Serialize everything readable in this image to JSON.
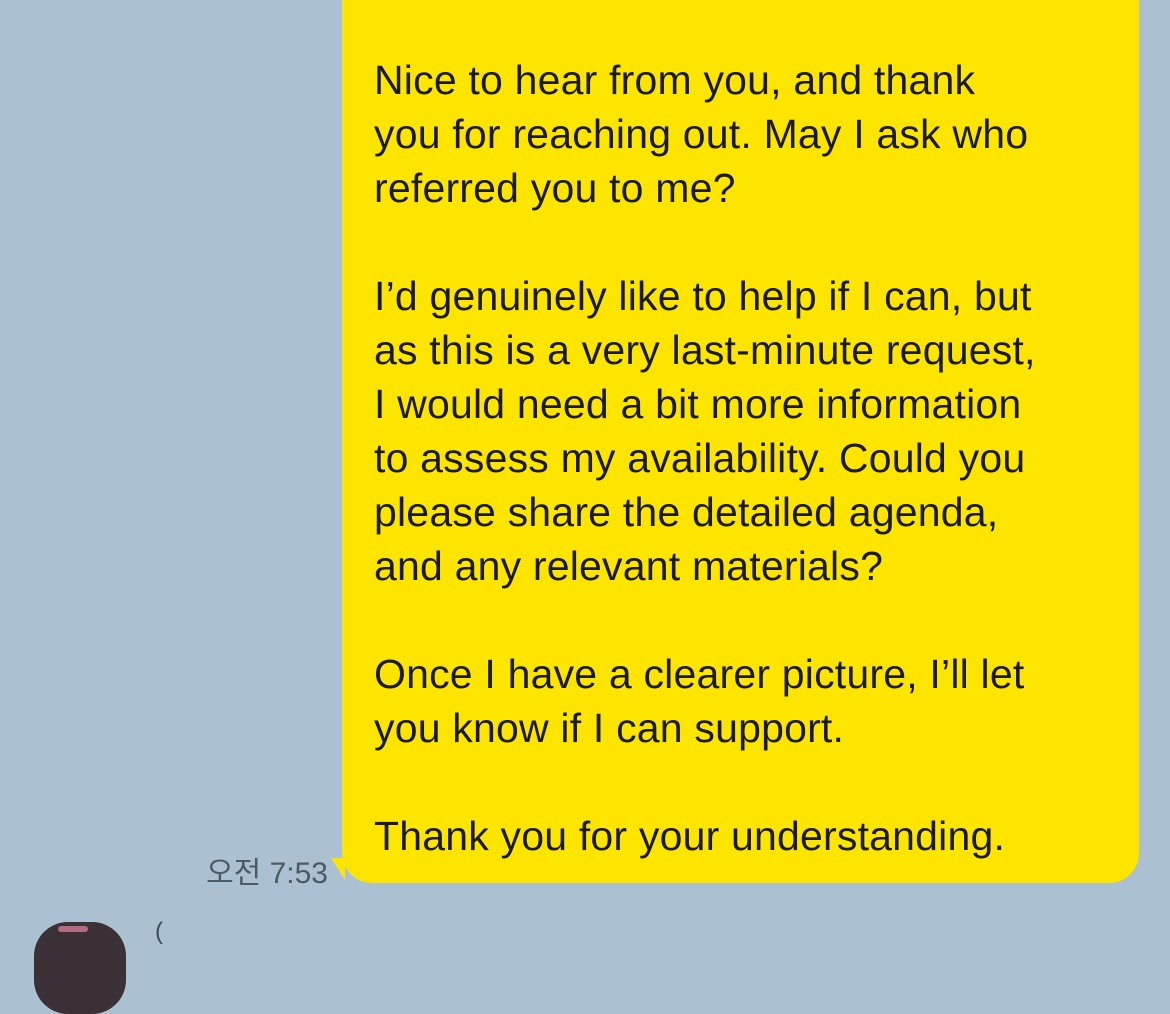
{
  "message": {
    "paragraphs": [
      "Nice to hear from you, and thank\nyou for reaching out. May I ask who\nreferred you to me?",
      "I’d genuinely like to help if I can, but\nas this is a very last-minute request,\nI would need a bit more information\nto assess my availability. Could you\nplease share the detailed agenda,\nand any relevant materials?",
      "Once I have a clearer picture, I’ll let\nyou know if I can support.",
      "Thank you for your understanding."
    ],
    "timestamp": "오전 7:53",
    "bubble_color": "#fee500"
  },
  "next_message": {
    "sender_name_fragment": "("
  },
  "theme": {
    "chat_background": "#abc1d1"
  }
}
